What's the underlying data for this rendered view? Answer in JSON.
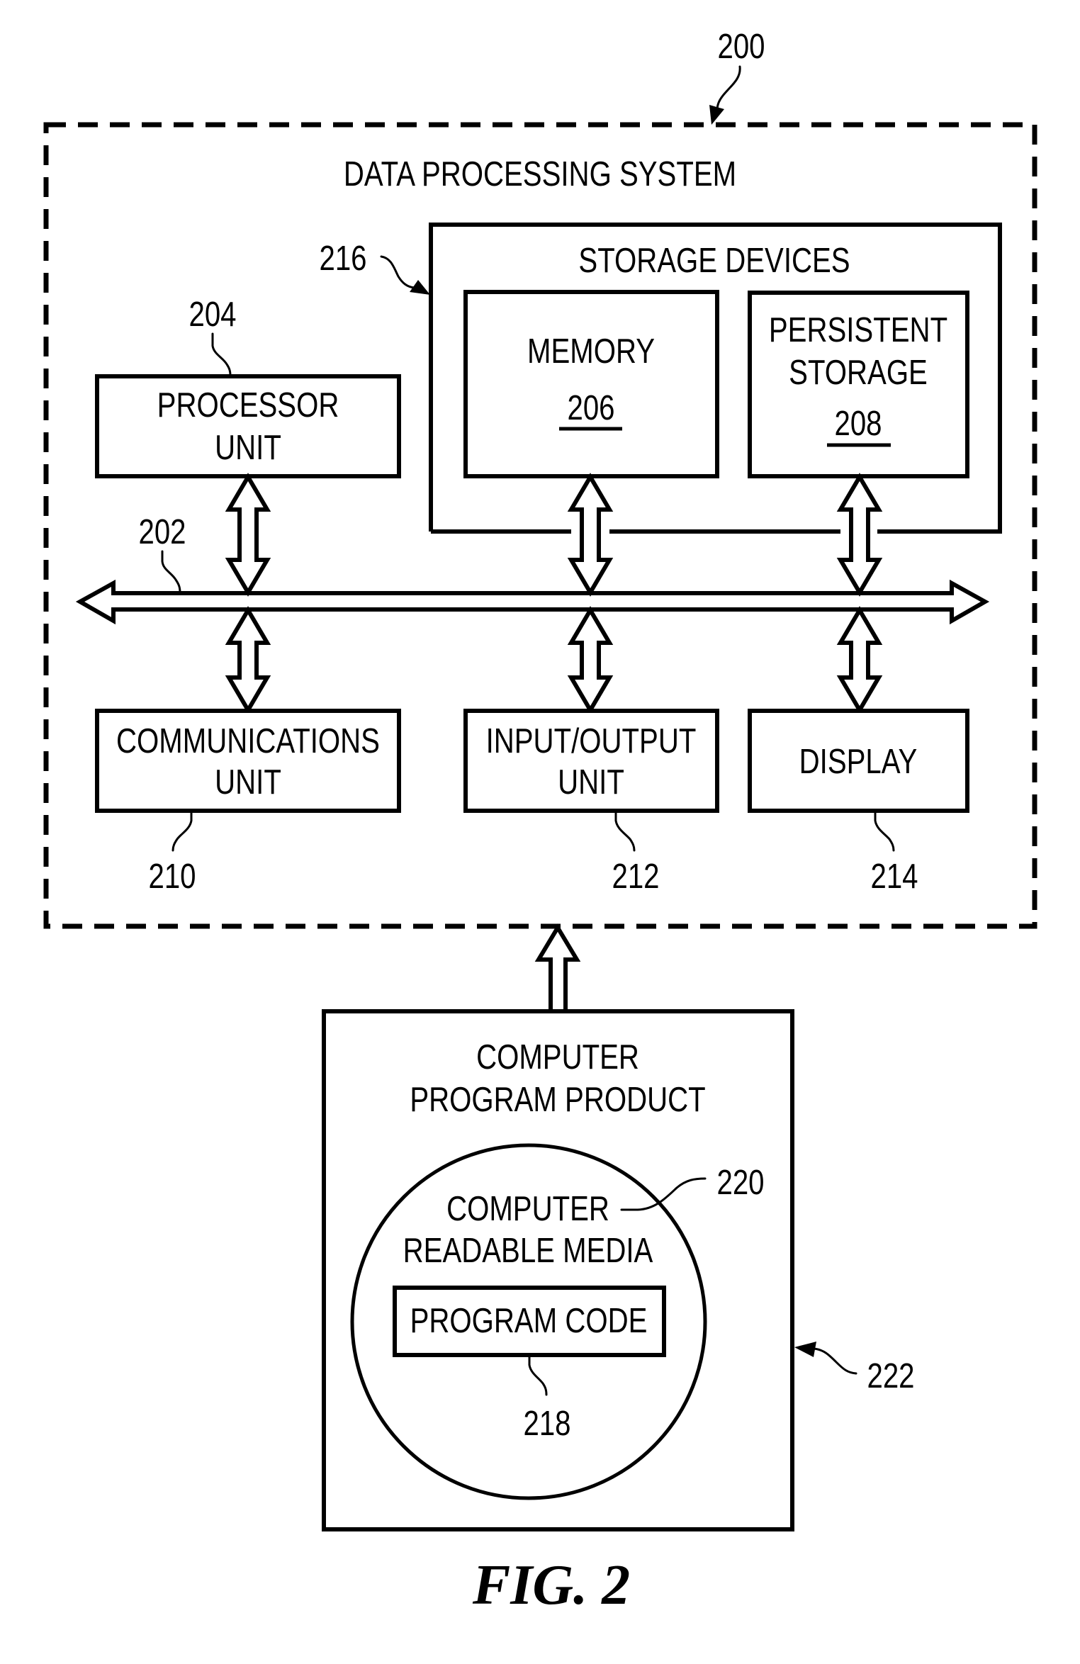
{
  "figure": {
    "caption": "FIG. 2",
    "system": {
      "ref": "200",
      "title": "DATA PROCESSING SYSTEM"
    },
    "bus": {
      "ref": "202"
    },
    "processor_unit": {
      "ref": "204",
      "line1": "PROCESSOR",
      "line2": "UNIT"
    },
    "storage_devices": {
      "ref": "216",
      "title": "STORAGE DEVICES",
      "memory": {
        "line1": "MEMORY",
        "ref": "206"
      },
      "persistent_storage": {
        "line1": "PERSISTENT",
        "line2": "STORAGE",
        "ref": "208"
      }
    },
    "communications_unit": {
      "ref": "210",
      "line1": "COMMUNICATIONS",
      "line2": "UNIT"
    },
    "io_unit": {
      "ref": "212",
      "line1": "INPUT/OUTPUT",
      "line2": "UNIT"
    },
    "display": {
      "ref": "214",
      "line1": "DISPLAY"
    },
    "computer_program_product": {
      "ref": "222",
      "line1": "COMPUTER",
      "line2": "PROGRAM PRODUCT",
      "computer_readable_media": {
        "ref": "220",
        "line1": "COMPUTER",
        "line2": "READABLE MEDIA",
        "program_code": {
          "ref": "218",
          "label": "PROGRAM CODE"
        }
      }
    }
  }
}
